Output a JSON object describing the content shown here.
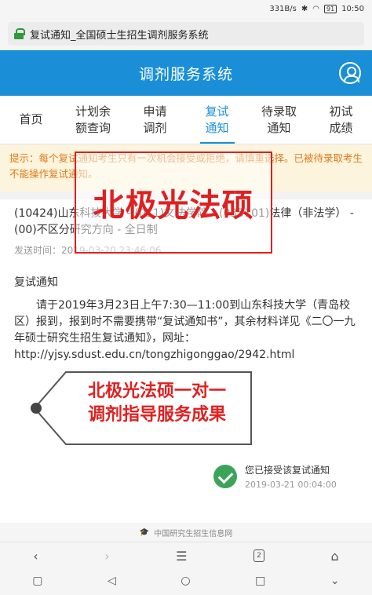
{
  "status_bar": {
    "network": "331B/s",
    "battery": "91",
    "time": "10:50"
  },
  "browser": {
    "url_title": "复试通知_全国硕士生招生调剂服务系统"
  },
  "header": {
    "title": "调剂服务系统"
  },
  "tabs": [
    {
      "label": "首页"
    },
    {
      "label": "计划余\n额查询"
    },
    {
      "label": "申请\n调剂"
    },
    {
      "label": "复试\n通知"
    },
    {
      "label": "待录取\n通知"
    },
    {
      "label": "初试\n成绩"
    }
  ],
  "warning": {
    "text": "提示：每个复试通知考生只有一次机会接受或拒绝，请慎重选择。已被待录取考生不能操作复试通知。"
  },
  "notice_info": {
    "school": "(10424)山东科技大学 - (011)文法学院 - (035101)法律（非法学） - (00)不区分研究方向 - 全日制",
    "sent_time": "发送时间：2019-03-20 23:46:06"
  },
  "notice": {
    "title": "复试通知",
    "body": "请于2019年3月23日上午7:30—11:00到山东科技大学（青岛校区）报到，报到时不需要携带“复试通知书”，其余材料详见《二〇一九年硕士研究生招生复试通知》，网址：http://yjsy.sdust.edu.cn/tongzhigonggao/2942.html"
  },
  "accept": {
    "text": "您已接受该复试通知",
    "time": "2019-03-21 00:04:00"
  },
  "footer": {
    "text": "中国研究生招生信息网"
  },
  "nav": {
    "tab_count": "2"
  },
  "watermark": {
    "text1": "北极光法硕",
    "line1": "北极光法硕一对一",
    "line2": "调剂指导服务成果"
  },
  "colors": {
    "brand": "#1a8fd8",
    "warning_text": "#e07a1e",
    "warning_bg": "#fcf4dc",
    "accept": "#3ba35a",
    "watermark": "#e02020"
  }
}
